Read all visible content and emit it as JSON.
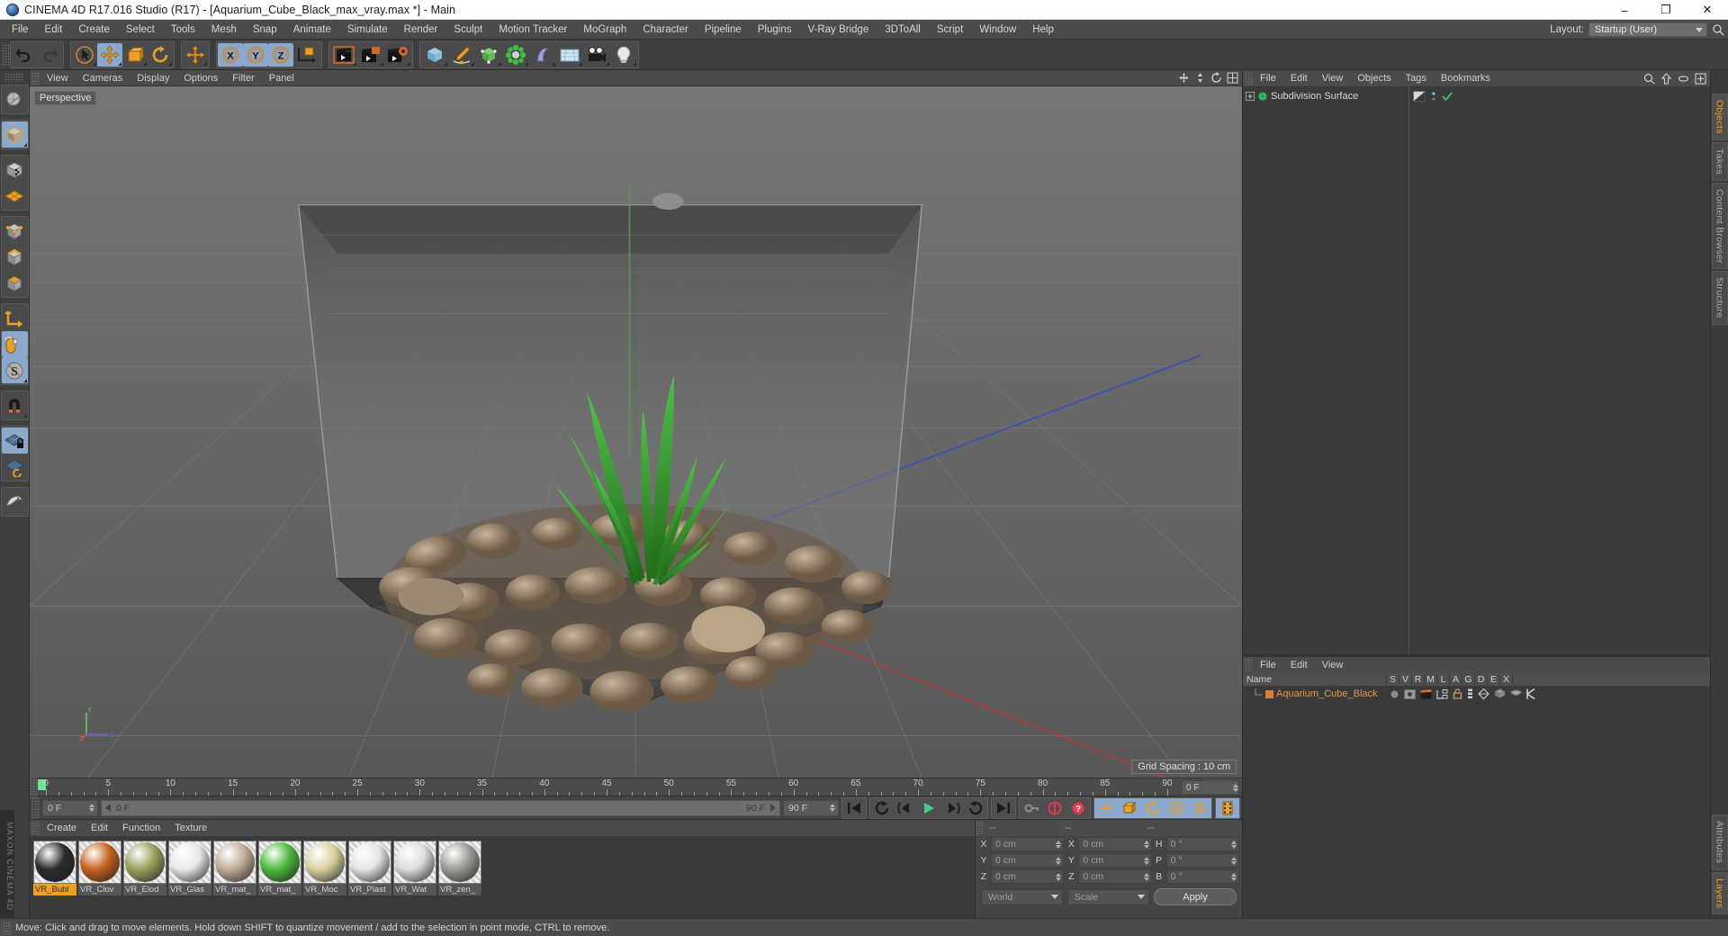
{
  "window": {
    "title": "CINEMA 4D R17.016 Studio (R17) - [Aquarium_Cube_Black_max_vray.max *] - Main",
    "minimize": "–",
    "maximize": "❐",
    "close": "✕"
  },
  "menubar": {
    "items": [
      "File",
      "Edit",
      "Create",
      "Select",
      "Tools",
      "Mesh",
      "Snap",
      "Animate",
      "Simulate",
      "Render",
      "Sculpt",
      "Motion Tracker",
      "MoGraph",
      "Character",
      "Pipeline",
      "Plugins",
      "V-Ray Bridge",
      "3DToAll",
      "Script",
      "Window",
      "Help"
    ],
    "layout_label": "Layout:",
    "layout_value": "Startup (User)",
    "search_icon": "search-icon"
  },
  "viewport": {
    "menu": [
      "View",
      "Cameras",
      "Display",
      "Options",
      "Filter",
      "Panel"
    ],
    "label": "Perspective",
    "grid_spacing": "Grid Spacing : 10 cm",
    "axis": {
      "y": "Y",
      "x": "X",
      "z": "Z"
    }
  },
  "timeline": {
    "ticks": [
      0,
      5,
      10,
      15,
      20,
      25,
      30,
      35,
      40,
      45,
      50,
      55,
      60,
      65,
      70,
      75,
      80,
      85,
      90
    ],
    "current_frame": "0 F",
    "range_start": "0 F",
    "range_end": "90 F",
    "end_field": "90 F",
    "right_field": "0 F"
  },
  "materials": {
    "menu": [
      "Create",
      "Edit",
      "Function",
      "Texture"
    ],
    "items": [
      {
        "name": "VR_Bubl",
        "selected": true,
        "color": "#2b2b2b"
      },
      {
        "name": "VR_Clov",
        "selected": false,
        "color": "#c4621c"
      },
      {
        "name": "VR_Elod",
        "selected": false,
        "color": "#9aa05a"
      },
      {
        "name": "VR_Glas",
        "selected": false,
        "color": "#e8e8e8"
      },
      {
        "name": "VR_mat_",
        "selected": false,
        "color": "#c2ad97"
      },
      {
        "name": "VR_mat_",
        "selected": false,
        "color": "#4cb83c"
      },
      {
        "name": "VR_Moc",
        "selected": false,
        "color": "#d9cf9e"
      },
      {
        "name": "VR_Plast",
        "selected": false,
        "color": "#e4e4e4"
      },
      {
        "name": "VR_Wat",
        "selected": false,
        "color": "#dcdcdc"
      },
      {
        "name": "VR_zen_",
        "selected": false,
        "color": "#9b9b94"
      }
    ]
  },
  "coordinates": {
    "header": [
      "--",
      "--",
      "--"
    ],
    "rows": [
      {
        "l1": "X",
        "v1": "0 cm",
        "l2": "X",
        "v2": "0 cm",
        "l3": "H",
        "v3": "0 °"
      },
      {
        "l1": "Y",
        "v1": "0 cm",
        "l2": "Y",
        "v2": "0 cm",
        "l3": "P",
        "v3": "0 °"
      },
      {
        "l1": "Z",
        "v1": "0 cm",
        "l2": "Z",
        "v2": "0 cm",
        "l3": "B",
        "v3": "0 °"
      }
    ],
    "system": "World",
    "mode": "Scale",
    "apply": "Apply"
  },
  "object_manager": {
    "menu": [
      "File",
      "Edit",
      "View",
      "Objects",
      "Tags",
      "Bookmarks"
    ],
    "rows": [
      {
        "label": "Subdivision Surface"
      }
    ]
  },
  "layer_manager": {
    "menu": [
      "File",
      "Edit",
      "View"
    ],
    "columns": [
      "Name",
      "S",
      "V",
      "R",
      "M",
      "L",
      "A",
      "G",
      "D",
      "E",
      "X"
    ],
    "rows": [
      {
        "name": "Aquarium_Cube_Black",
        "color": "#e07a2c"
      }
    ]
  },
  "side_tabs": {
    "top": [
      "Objects",
      "Takes",
      "Content Browser",
      "Structure"
    ],
    "bottom": [
      "Attributes",
      "Layers"
    ],
    "active_top": "Objects",
    "active_bottom": "Layers"
  },
  "statusbar": {
    "message": "Move: Click and drag to move elements. Hold down SHIFT to quantize movement / add to the selection in point mode, CTRL to remove."
  },
  "branding": {
    "text": "MAXON CINEMA 4D"
  },
  "colors": {
    "accent_orange": "#f0a01e",
    "highlight_blue": "#8aa9cc",
    "panel_bg": "#3f3f3f",
    "viewport_bg": "#686868"
  }
}
